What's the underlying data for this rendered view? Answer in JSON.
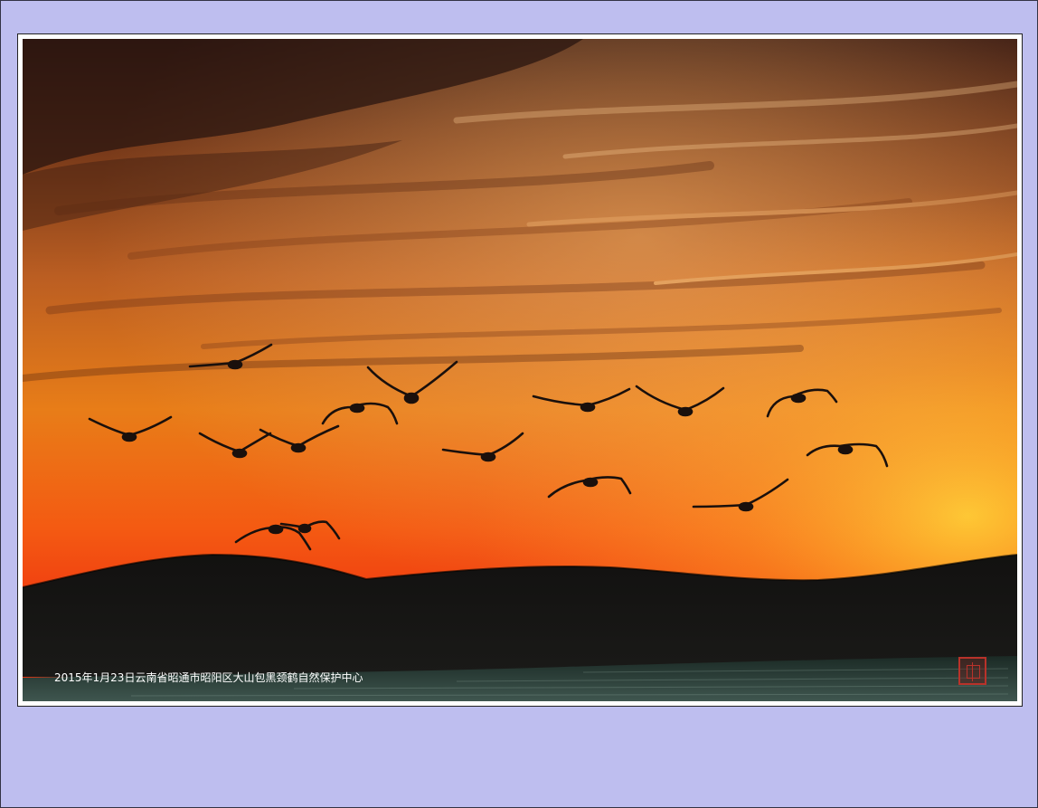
{
  "page": {
    "background_color": "#bebeef"
  },
  "photo": {
    "caption": "2015年1月23日云南省昭通市昭阳区大山包黑颈鹤自然保护中心",
    "caption_color": "#ffffff",
    "subject": "black-necked cranes flying over hills at sunset",
    "bird_count": 15,
    "seal_color": "#b9322a"
  }
}
